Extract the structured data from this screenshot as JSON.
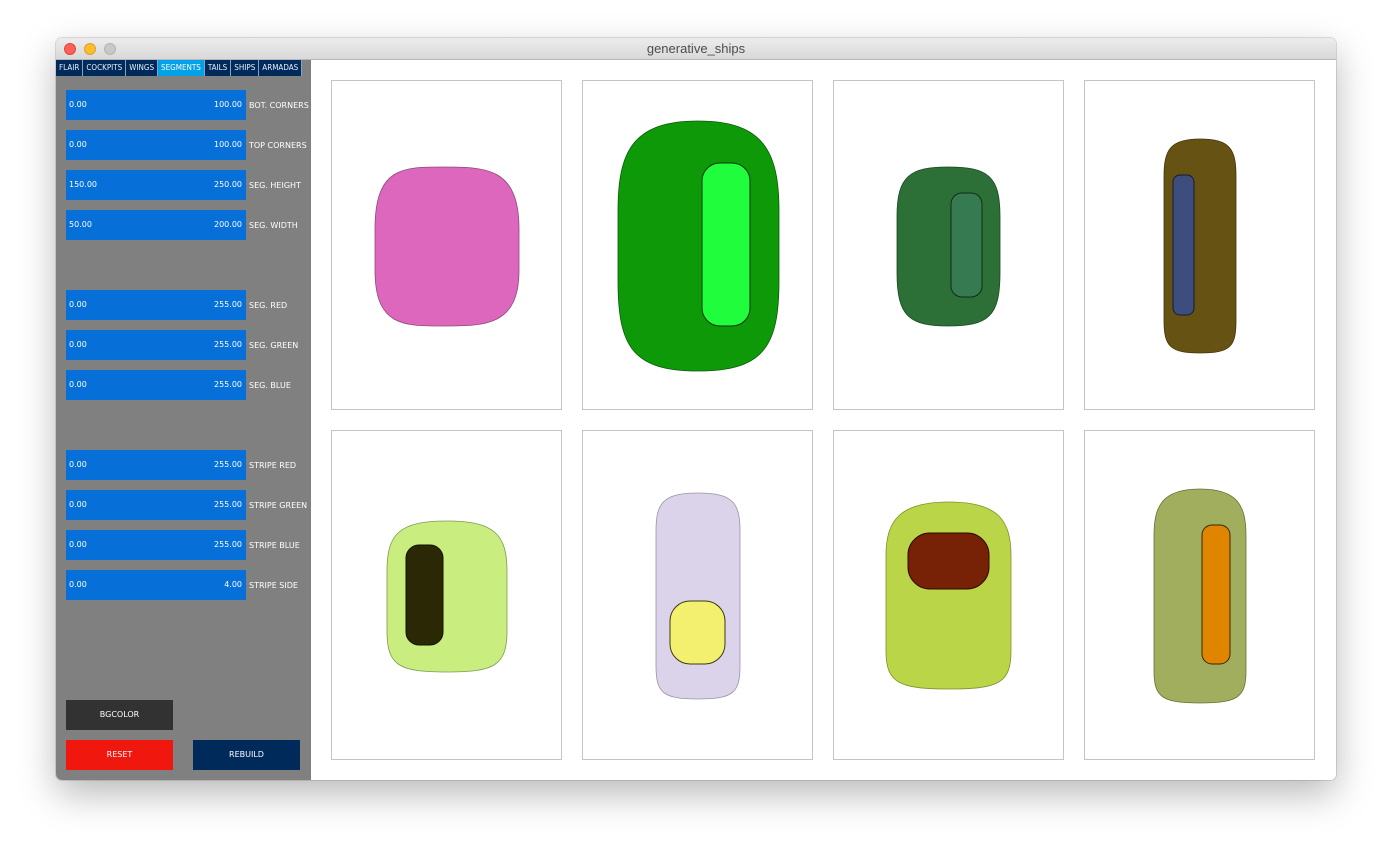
{
  "window": {
    "title": "generative_ships"
  },
  "tabs": [
    {
      "label": "FLAIR",
      "active": false
    },
    {
      "label": "COCKPITS",
      "active": false
    },
    {
      "label": "WINGS",
      "active": false
    },
    {
      "label": "SEGMENTS",
      "active": true
    },
    {
      "label": "TAILS",
      "active": false
    },
    {
      "label": "SHIPS",
      "active": false
    },
    {
      "label": "ARMADAS",
      "active": false
    }
  ],
  "controls": {
    "bot_corners": {
      "min": "0.00",
      "max": "100.00",
      "label": "BOT. CORNERS"
    },
    "top_corners": {
      "min": "0.00",
      "max": "100.00",
      "label": "TOP CORNERS"
    },
    "seg_height": {
      "min": "150.00",
      "max": "250.00",
      "label": "SEG. HEIGHT"
    },
    "seg_width": {
      "min": "50.00",
      "max": "200.00",
      "label": "SEG. WIDTH"
    },
    "seg_red": {
      "min": "0.00",
      "max": "255.00",
      "label": "SEG. RED"
    },
    "seg_green": {
      "min": "0.00",
      "max": "255.00",
      "label": "SEG. GREEN"
    },
    "seg_blue": {
      "min": "0.00",
      "max": "255.00",
      "label": "SEG. BLUE"
    },
    "stripe_red": {
      "min": "0.00",
      "max": "255.00",
      "label": "STRIPE RED"
    },
    "stripe_green": {
      "min": "0.00",
      "max": "255.00",
      "label": "STRIPE GREEN"
    },
    "stripe_blue": {
      "min": "0.00",
      "max": "255.00",
      "label": "STRIPE BLUE"
    },
    "stripe_side": {
      "min": "0.00",
      "max": "4.00",
      "label": "STRIPE SIDE"
    }
  },
  "buttons": {
    "bgcolor": "BGCOLOR",
    "reset": "RESET",
    "rebuild": "REBUILD"
  },
  "colors": {
    "sidebar_bg": "#808080",
    "slider": "#0670d8",
    "tab_active": "#03a1e8",
    "tab_inactive": "#002a5a",
    "reset": "#f0180e",
    "rebuild": "#002a5a",
    "bgcolor_button": "#323232"
  },
  "segments": [
    {
      "fill": "#dc67bd",
      "stripe": null
    },
    {
      "fill": "#0e9a08",
      "stripe": "#1ffd3c"
    },
    {
      "fill": "#2c6f37",
      "stripe": "#367a52"
    },
    {
      "fill": "#665314",
      "stripe": "#3d4e7e"
    },
    {
      "fill": "#c9ed7e",
      "stripe": "#2a2805"
    },
    {
      "fill": "#dbd3ea",
      "stripe": "#f2f06e"
    },
    {
      "fill": "#bad548",
      "stripe": "#772106"
    },
    {
      "fill": "#a1ae5e",
      "stripe": "#e08500"
    }
  ]
}
